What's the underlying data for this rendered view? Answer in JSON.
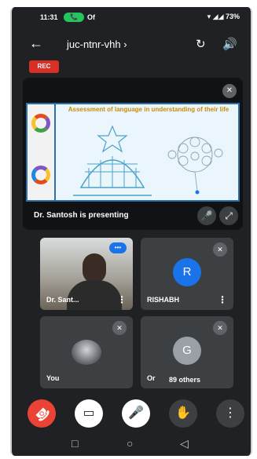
{
  "status_bar": {
    "time": "11:31",
    "call_pill": "Of",
    "extra": "Of",
    "right_icons": "▾ ◢◢ 73%"
  },
  "top_bar": {
    "meeting_code": "juc-ntnr-vhh",
    "chevron": "›",
    "back_icon": "←",
    "switch_camera_icon": "↻",
    "speaker_icon": "🔊"
  },
  "rec_badge": "REC",
  "presentation": {
    "slide_title": "Assessment of language in understanding of their life",
    "presenter_caption": "Dr. Santosh is presenting",
    "mute_icon": "🎤̸",
    "unpin_icon": "⤢"
  },
  "participants": [
    {
      "name": "Dr. Sant...",
      "type": "video",
      "speaking_badge": "•••"
    },
    {
      "name": "RISHABH",
      "type": "avatar",
      "initial": "R",
      "avatar_color": "#1a73e8"
    },
    {
      "name": "You",
      "type": "self"
    },
    {
      "name": "Or",
      "others_label": "89 others",
      "type": "avatar",
      "initial": "G",
      "avatar_color": "#9aa0a6"
    }
  ],
  "controls": [
    {
      "name": "end-call",
      "glyph": "☎",
      "color": "#ea4335"
    },
    {
      "name": "camera-off",
      "glyph": "▭",
      "color": "#ffffff"
    },
    {
      "name": "mic-off",
      "glyph": "🎤",
      "color": "#ffffff"
    },
    {
      "name": "raise-hand",
      "glyph": "✋",
      "color": "#3c4043"
    },
    {
      "name": "more",
      "glyph": "⋮",
      "color": "#3c4043"
    }
  ],
  "nav_bar": {
    "back": "◁",
    "home": "○",
    "recents": "□"
  }
}
